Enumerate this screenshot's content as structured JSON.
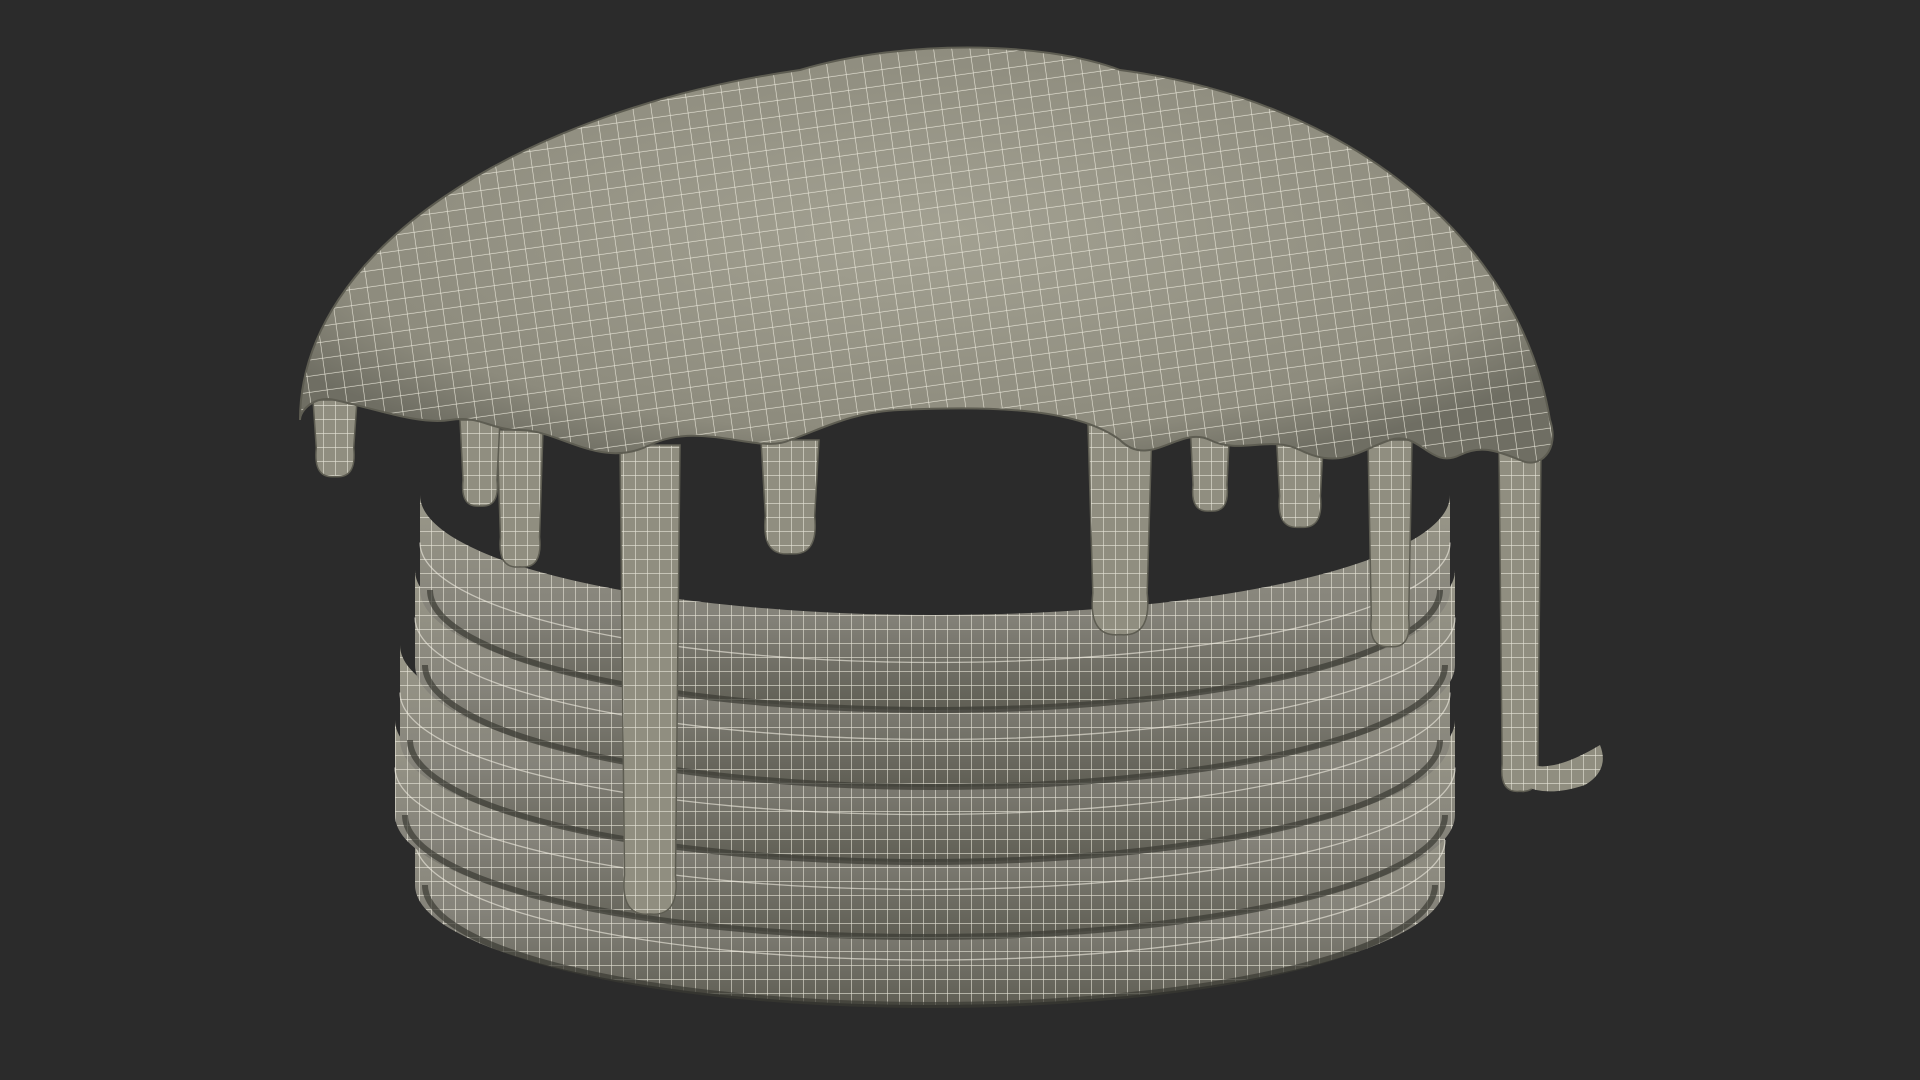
{
  "scene": {
    "subject": "pancake-stack-wireframe",
    "background_color": "#2b2b2b",
    "surface_color": "#8a8878",
    "surface_shadow_color": "#5e5d52",
    "wire_color": "#f1efe2",
    "pancake_count": 5,
    "syrup_drips": 10
  }
}
